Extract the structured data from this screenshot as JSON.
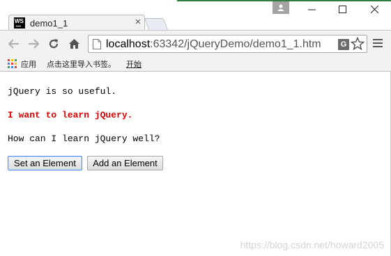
{
  "browser": {
    "tab": {
      "icon": "webstorm-icon",
      "icon_text": "WS",
      "title": "demo1_1",
      "close_glyph": "×"
    },
    "address": {
      "host": "localhost",
      "rest": ":63342/jQueryDemo/demo1_1.htm"
    },
    "translate_glyph": "G",
    "star_glyph": "☆",
    "bookmarks": {
      "apps_label": "应用",
      "import_prompt": "点击这里导入书签。",
      "start_label": "开始"
    }
  },
  "page": {
    "line1": "jQuery is so useful.",
    "line2": "I want to learn jQuery.",
    "line3": "How can I learn jQuery well?",
    "button_set": "Set an Element",
    "button_add": "Add an Element",
    "watermark": "https://blog.csdn.net/howard2005"
  },
  "colors": {
    "highlight_text": "#e00000",
    "focus_border": "#4d90fe",
    "apps_icon": [
      "#e94235",
      "#fbbc05",
      "#34a853",
      "#4285f4",
      "#ea4335",
      "#fbbc05",
      "#34a853",
      "#4285f4",
      "#e94235"
    ]
  }
}
